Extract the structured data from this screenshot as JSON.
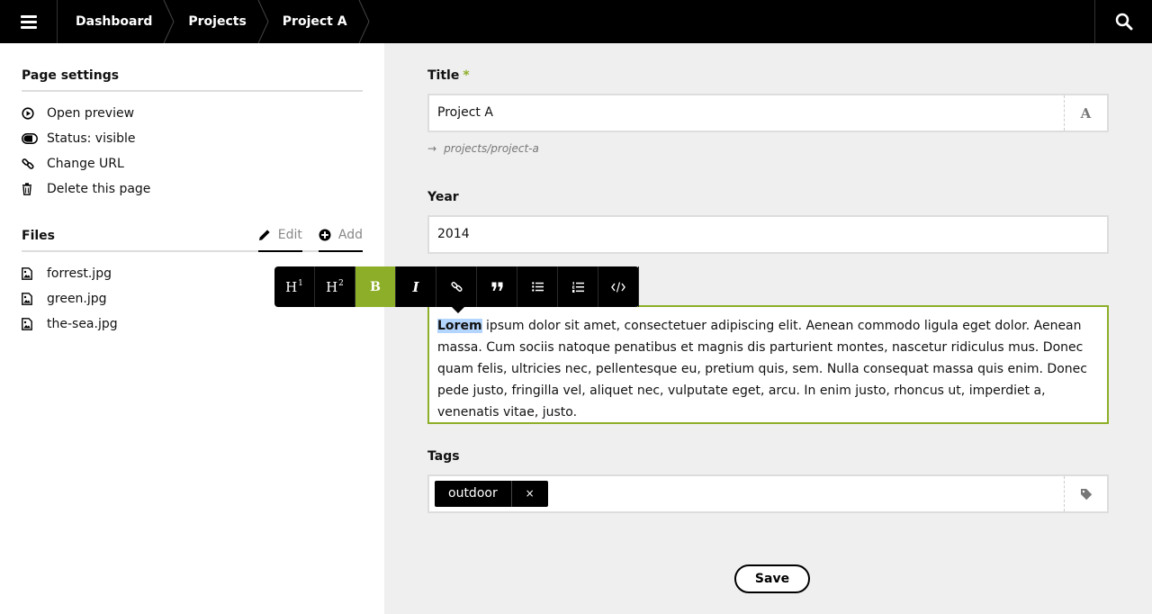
{
  "topbar": {
    "breadcrumbs": [
      "Dashboard",
      "Projects",
      "Project A"
    ]
  },
  "sidebar": {
    "page_settings": {
      "heading": "Page settings",
      "items": [
        {
          "label": "Open preview",
          "icon": "play-circle-icon"
        },
        {
          "label": "Status: visible",
          "icon": "toggle-icon"
        },
        {
          "label": "Change URL",
          "icon": "link-icon"
        },
        {
          "label": "Delete this page",
          "icon": "trash-icon"
        }
      ]
    },
    "files": {
      "heading": "Files",
      "edit_label": "Edit",
      "add_label": "Add",
      "items": [
        "forrest.jpg",
        "green.jpg",
        "the-sea.jpg"
      ]
    }
  },
  "form": {
    "title": {
      "label": "Title",
      "required_mark": "*",
      "value": "Project A",
      "url_hint": "projects/project-a"
    },
    "year": {
      "label": "Year",
      "value": "2014"
    },
    "text": {
      "highlighted": "Lorem",
      "rest": " ipsum dolor sit amet, consectetuer adipiscing elit. Aenean commodo ligula eget dolor. Aenean massa. Cum sociis natoque penatibus et magnis dis parturient montes, nascetur ridiculus mus. Donec quam felis, ultricies nec, pellentesque eu, pretium quis, sem. Nulla consequat massa quis enim. Donec pede justo, fringilla vel, aliquet nec, vulputate eget, arcu. In enim justo, rhoncus ut, imperdiet a, venenatis vitae, justo."
    },
    "tags": {
      "label": "Tags",
      "items": [
        "outdoor"
      ],
      "remove_glyph": "×"
    },
    "save_label": "Save"
  },
  "toolbar": {
    "buttons": [
      {
        "name": "h1",
        "label": "H",
        "sup": "1"
      },
      {
        "name": "h2",
        "label": "H",
        "sup": "2"
      },
      {
        "name": "bold",
        "label": "B",
        "active": true
      },
      {
        "name": "italic",
        "label": "I"
      },
      {
        "name": "link",
        "icon": "link-icon"
      },
      {
        "name": "quote",
        "icon": "quote-icon"
      },
      {
        "name": "bullet-list",
        "icon": "bullet-list-icon"
      },
      {
        "name": "ordered-list",
        "icon": "ordered-list-icon"
      },
      {
        "name": "code",
        "icon": "code-icon"
      }
    ]
  },
  "colors": {
    "accent": "#8dae28",
    "topbar": "#000000",
    "selection": "#b4d5fe"
  }
}
